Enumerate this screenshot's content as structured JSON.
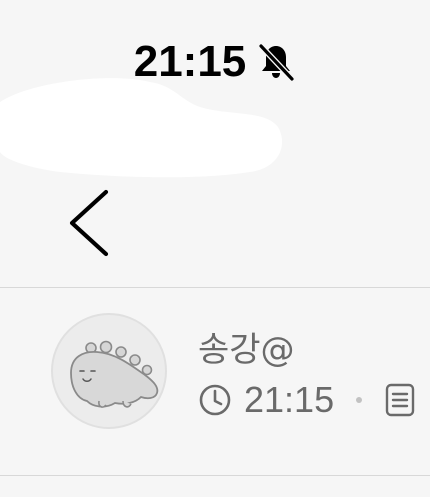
{
  "status_bar": {
    "time": "21:15",
    "bell_icon": "bell-slash-icon"
  },
  "nav": {
    "back_icon": "chevron-left-icon"
  },
  "message": {
    "sender_name": "송강@",
    "time": "21:15",
    "avatar": "dinosaur-avatar",
    "clock_icon": "clock-icon",
    "doc_icon": "document-icon"
  },
  "colors": {
    "background": "#f6f6f6",
    "secondary_text": "#6a6a6a",
    "divider": "#d8d8d8"
  }
}
